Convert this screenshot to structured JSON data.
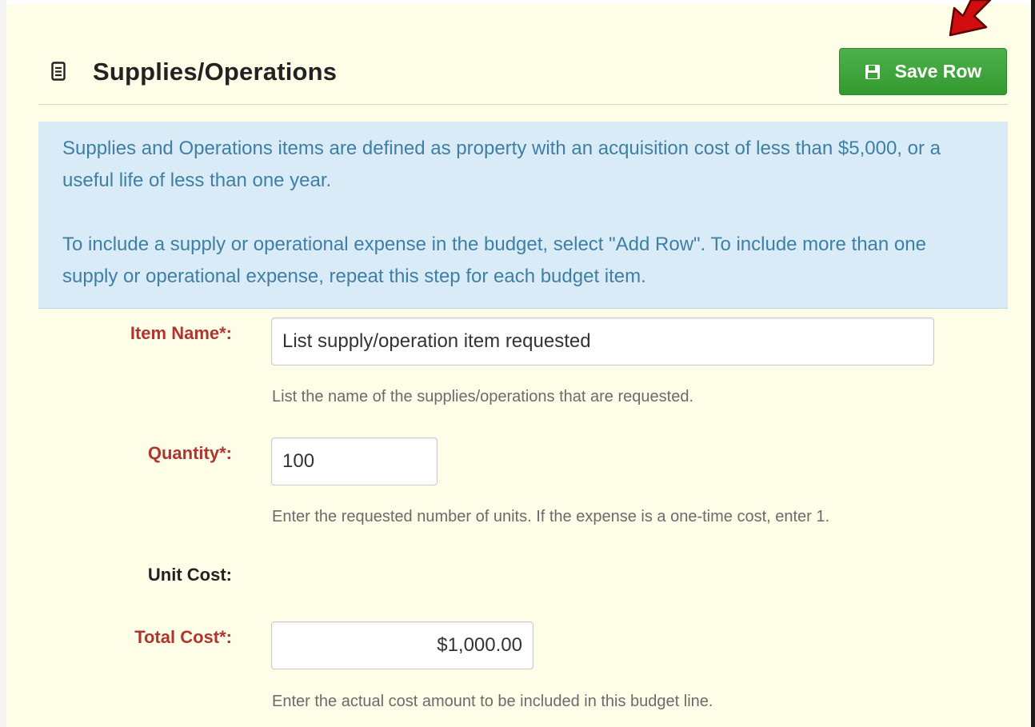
{
  "section": {
    "title": "Supplies/Operations",
    "icon": "document-icon"
  },
  "toolbar": {
    "save_label": "Save Row",
    "save_icon": "floppy-disk-icon",
    "accent_color": "#3aa436"
  },
  "info": {
    "paragraph_1": "Supplies and Operations items are defined as property with an acquisition cost of less than $5,000, or a useful life of less than one year.",
    "paragraph_2": "To include a supply or operational expense in the budget, select \"Add Row\". To include more than one supply or operational expense, repeat this step for each budget item."
  },
  "form": {
    "item_name": {
      "label": "Item Name*:",
      "value": "List supply/operation item requested",
      "help": "List the name of the supplies/operations that are requested."
    },
    "quantity": {
      "label": "Quantity*:",
      "value": "100",
      "help": "Enter the requested number of units. If the expense is a one-time cost, enter 1."
    },
    "unit_cost": {
      "label": "Unit Cost:"
    },
    "total_cost": {
      "label": "Total Cost*:",
      "value": "$1,000.00",
      "help": "Enter the actual cost amount to be included in this budget line."
    }
  },
  "colors": {
    "panel_background": "#fefde8",
    "info_background": "#d8ebf6",
    "info_text": "#3f7fa6",
    "required_label": "#b0352f",
    "annotation_arrow": "#d10d0d"
  }
}
